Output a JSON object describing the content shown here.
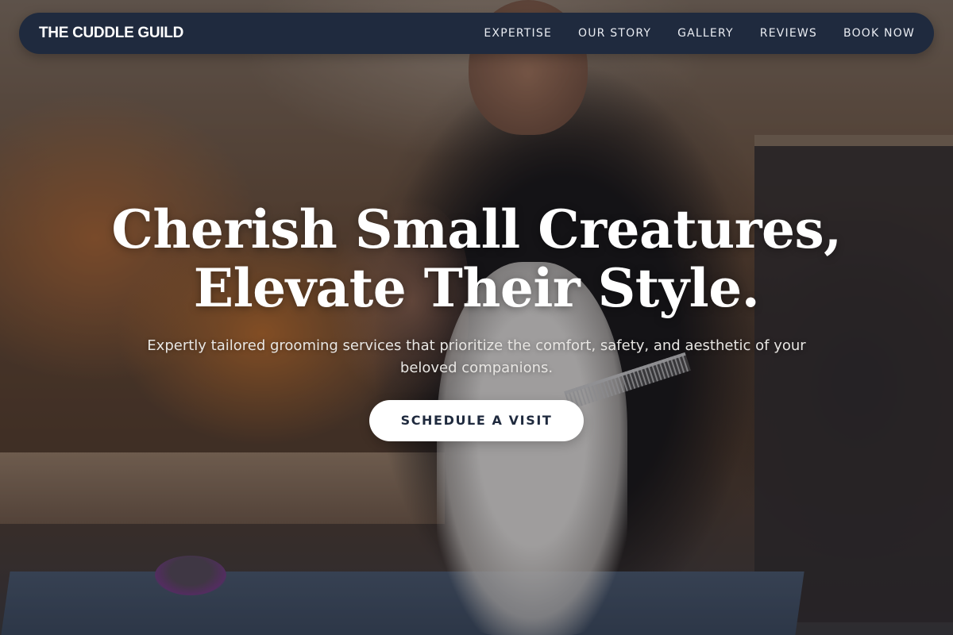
{
  "brand": {
    "name": "THE CUDDLE GUILD"
  },
  "nav": {
    "items": [
      {
        "label": "EXPERTISE"
      },
      {
        "label": "OUR STORY"
      },
      {
        "label": "GALLERY"
      },
      {
        "label": "REVIEWS"
      },
      {
        "label": "BOOK NOW"
      }
    ]
  },
  "hero": {
    "headline_line1": "Cherish Small Creatures,",
    "headline_line2": "Elevate Their Style.",
    "subtitle": "Expertly tailored grooming services that prioritize the comfort, safety, and aesthetic of your beloved companions.",
    "cta_label": "SCHEDULE A VISIT"
  },
  "colors": {
    "nav_background": "#1f2a3e",
    "cta_background": "#ffffff",
    "cta_text": "#1f2a3e",
    "headline_text": "#ffffff"
  }
}
